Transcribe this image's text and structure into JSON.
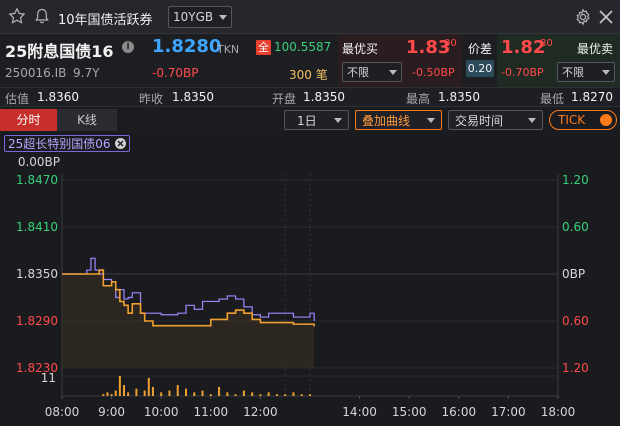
{
  "header": {
    "title": "10年国债活跃券",
    "selector": "10YGB"
  },
  "quote": {
    "name": "25附息国债16",
    "code": "250016.IB",
    "term": "9.7Y",
    "price": "1.8280",
    "source": "TKN",
    "full_badge": "全",
    "full_price": "100.5587",
    "change_bp": "-0.70BP",
    "volume": "300 笔",
    "best_bid_label": "最优买",
    "best_bid_main": "1.83",
    "best_bid_sup": "00",
    "best_bid_bp": "-0.50BP",
    "bid_filter": "不限",
    "spread_label": "价差",
    "spread": "0.20",
    "best_ask_label": "最优卖",
    "best_ask_main": "1.82",
    "best_ask_sup": "80",
    "best_ask_bp": "-0.70BP",
    "ask_filter": "不限"
  },
  "stats": {
    "est_label": "估值",
    "est": "1.8360",
    "prev_label": "昨收",
    "prev": "1.8350",
    "open_label": "开盘",
    "open": "1.8350",
    "high_label": "最高",
    "high": "1.8350",
    "low_label": "最低",
    "low": "1.8270"
  },
  "toolbar": {
    "tab_intraday": "分时",
    "tab_kline": "K线",
    "period": "1日",
    "overlay": "叠加曲线",
    "session": "交易时间",
    "tick": "TICK"
  },
  "overlay_tag": "25超长特别国债06",
  "colors": {
    "price_line": "#f0a030",
    "overlay_line": "#9f86ff",
    "up": "#ff4a4a",
    "down": "#39d07a",
    "accent": "#ff7a1a"
  },
  "chart_data": {
    "type": "line",
    "top_bp_label": "0.00BP",
    "y_left_ticks": [
      "1.8470",
      "1.8410",
      "1.8350",
      "1.8290",
      "1.8230"
    ],
    "y_right_ticks": [
      "1.20",
      "0.60",
      "0BP",
      "0.60",
      "1.20"
    ],
    "ylim": [
      1.823,
      1.847
    ],
    "volume_tick": "11",
    "x_ticks": [
      "08:00",
      "9:00",
      "10:00",
      "11:00",
      "12:00",
      "14:00",
      "15:00",
      "16:00",
      "17:00",
      "18:00"
    ],
    "series": [
      {
        "name": "25附息国债16",
        "x": [
          "08:00",
          "08:30",
          "08:35",
          "08:40",
          "08:45",
          "08:50",
          "09:00",
          "09:05",
          "09:10",
          "09:15",
          "09:20",
          "09:25",
          "09:35",
          "09:40",
          "09:50",
          "10:00",
          "10:10",
          "10:20",
          "10:30",
          "10:40",
          "10:50",
          "11:00",
          "11:10",
          "11:20",
          "11:30",
          "11:40",
          "11:50",
          "12:00",
          "12:10",
          "12:20",
          "12:30",
          "12:40",
          "12:50",
          "13:00",
          "13:05"
        ],
        "values": [
          1.835,
          1.835,
          1.835,
          1.835,
          1.8355,
          1.8335,
          1.834,
          1.833,
          1.8315,
          1.831,
          1.83,
          1.8312,
          1.83,
          1.829,
          1.8284,
          1.8284,
          1.8284,
          1.8284,
          1.8284,
          1.8284,
          1.8284,
          1.8292,
          1.8292,
          1.83,
          1.8304,
          1.83,
          1.8292,
          1.8288,
          1.8288,
          1.8288,
          1.8288,
          1.8286,
          1.8286,
          1.8286,
          1.8283
        ]
      },
      {
        "name": "25超长特别国债06",
        "x": [
          "08:00",
          "08:30",
          "08:35",
          "08:40",
          "08:45",
          "08:50",
          "09:00",
          "09:05",
          "09:10",
          "09:15",
          "09:20",
          "09:25",
          "09:35",
          "09:40",
          "09:50",
          "10:00",
          "10:10",
          "10:20",
          "10:30",
          "10:40",
          "10:50",
          "11:00",
          "11:10",
          "11:20",
          "11:30",
          "11:40",
          "11:50",
          "12:00",
          "12:10",
          "12:20",
          "12:30",
          "12:40",
          "12:50",
          "13:00",
          "13:05"
        ],
        "values": [
          1.835,
          1.8355,
          1.837,
          1.8355,
          1.835,
          1.8343,
          1.834,
          1.832,
          1.833,
          1.8318,
          1.832,
          1.8326,
          1.83,
          1.83,
          1.83,
          1.8298,
          1.8298,
          1.83,
          1.831,
          1.8305,
          1.8315,
          1.8315,
          1.8318,
          1.8322,
          1.8318,
          1.8308,
          1.8298,
          1.8295,
          1.83,
          1.83,
          1.83,
          1.8295,
          1.8295,
          1.83,
          1.829
        ]
      }
    ],
    "volume": {
      "x": [
        "08:50",
        "08:55",
        "09:00",
        "09:05",
        "09:10",
        "09:15",
        "09:20",
        "09:30",
        "09:40",
        "09:45",
        "09:50",
        "10:00",
        "10:10",
        "10:20",
        "10:30",
        "10:40",
        "10:50",
        "11:00",
        "11:10",
        "11:20",
        "11:30",
        "11:40",
        "11:50",
        "12:00",
        "12:10",
        "12:20",
        "12:30",
        "12:40",
        "12:50",
        "13:00"
      ],
      "values": [
        1,
        2,
        1,
        3,
        11,
        6,
        2,
        4,
        3,
        10,
        5,
        2,
        3,
        6,
        4,
        2,
        3,
        1,
        5,
        2,
        1,
        3,
        2,
        1,
        2,
        1,
        1,
        2,
        1,
        1
      ]
    }
  }
}
